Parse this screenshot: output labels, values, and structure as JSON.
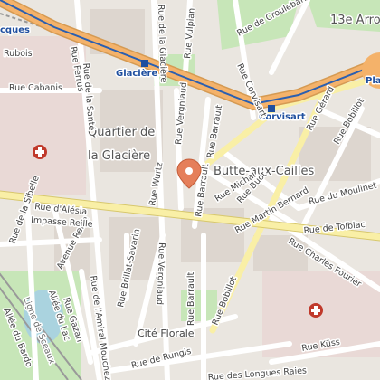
{
  "map": {
    "districts": {
      "q_glaciere_1": "Quartier de",
      "q_glaciere_2": "la Glacière",
      "butte": "Butte-aux-Cailles",
      "arrondissement": "13e Arro",
      "cite_florale": "Cité Florale"
    },
    "metro": {
      "glaciere": "Glacière",
      "corvisart": "Corvisart",
      "place": "Pla",
      "jacques": "cques"
    },
    "streets": {
      "alesia": "Rue d'Alésia",
      "tolbiac": "Rue de Tolbiac",
      "cabanis": "Rue Cabanis",
      "sante": "Rue de la Santé",
      "ferrus": "Rue Ferrus",
      "glaciere": "Rue de la Glacière",
      "vulpian": "Rue Vulpian",
      "croulebarbe": "Rue de Croulebarbe",
      "corvisart": "Rue Corvisart",
      "vergniaud_top": "Rue Vergniaud",
      "vergniaud_bottom": "Rue Vergniaud",
      "barrault_top": "Rue Barrault",
      "barrault_mid": "Rue Barrault",
      "barrault_bottom": "Rue Barrault",
      "wurtz": "Rue Wurtz",
      "buot": "Rue Buot",
      "michal": "Rue Michal",
      "martin_bernard": "Rue Martin Bernard",
      "moulinet": "Rue du Moulinet",
      "gerard": "Rue Gérard",
      "bobillot_top": "Rue Bobillot",
      "bobillot_bottom": "Rue Bobillot",
      "charles_fourier": "Rue Charles Fourier",
      "kuss": "Rue Küss",
      "rungis": "Rue de Rungis",
      "longues_raies": "Rue des Longues Raies",
      "brillat": "Rue Brillat-Savarin",
      "amiral": "Rue de l'Amiral Mouchez",
      "reille": "Avenue Reille",
      "impasse_reille": "Impasse Reille",
      "cazon": "Rue Gazan",
      "lac": "Allée du Lac",
      "ligne_sceaux": "Ligne de Sceaux",
      "bardo": "Allée du Bardo",
      "sibelle": "Rue de la Sibelle",
      "brillat_bottom": "Rue Brillat-Savarin",
      "cabanis_left": "Rubois"
    },
    "pin": {
      "icon": "location-pin-icon",
      "color": "#e57f5a"
    },
    "colors": {
      "highway": "#f4b26a",
      "primary": "#f9efa6",
      "park": "#c7e6b8",
      "water": "#aad3df",
      "hospital": "#c0392b",
      "metro_line": "#1f4f9f"
    }
  }
}
